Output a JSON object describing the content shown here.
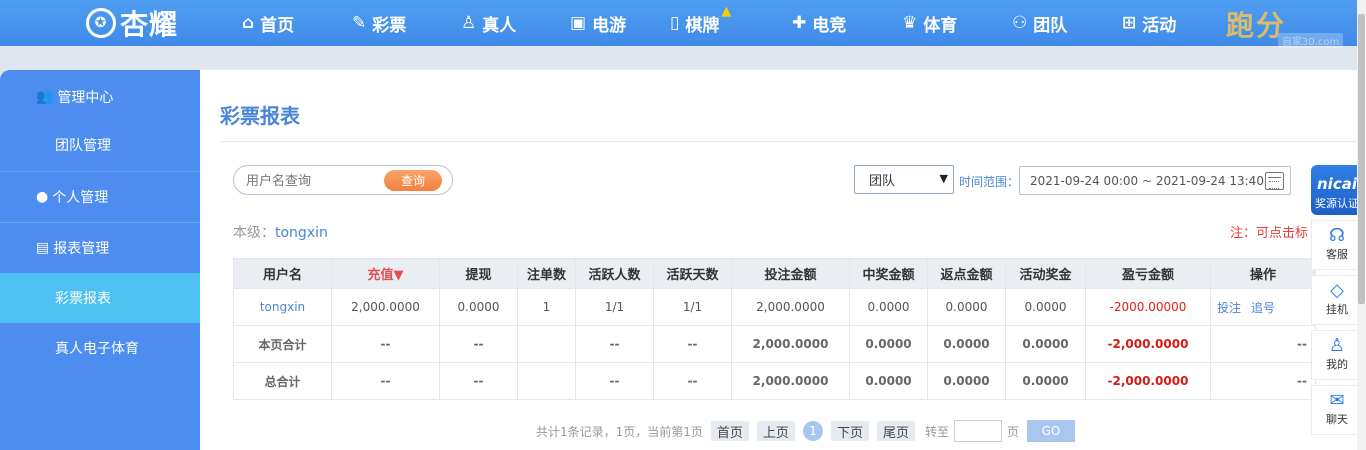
{
  "brand": {
    "logo_text": "杏耀",
    "watermark": "跑分",
    "site_tag": "自家30.com"
  },
  "nav": [
    {
      "label": "首页",
      "icon": "home-icon"
    },
    {
      "label": "彩票",
      "icon": "ticket-icon"
    },
    {
      "label": "真人",
      "icon": "person-icon"
    },
    {
      "label": "电游",
      "icon": "slot-icon"
    },
    {
      "label": "棋牌",
      "icon": "cards-icon"
    },
    {
      "label": "电竞",
      "icon": "gamepad-icon"
    },
    {
      "label": "体育",
      "icon": "trophy-icon"
    },
    {
      "label": "团队",
      "icon": "team-icon"
    },
    {
      "label": "活动",
      "icon": "gift-icon"
    }
  ],
  "sidebar": {
    "groups": [
      {
        "label": "管理中心",
        "icon": "users-icon"
      },
      {
        "label": "团队管理"
      },
      {
        "label": "个人管理",
        "icon": "user-icon"
      },
      {
        "label": "报表管理",
        "icon": "report-icon"
      },
      {
        "label": "彩票报表"
      },
      {
        "label": "真人电子体育"
      }
    ]
  },
  "page": {
    "title": "彩票报表"
  },
  "filters": {
    "search_placeholder": "用户名查询",
    "search_button": "查询",
    "scope_selected": "团队",
    "time_label": "时间范围：",
    "time_range": "2021-09-24 00:00 ~ 2021-09-24 13:40"
  },
  "level": {
    "prefix": "本级：",
    "username": "tongxin"
  },
  "note": "注：可点击标",
  "table": {
    "headers": [
      "用户名",
      "充值▼",
      "提现",
      "注单数",
      "活跃人数",
      "活跃天数",
      "投注金额",
      "中奖金额",
      "返点金额",
      "活动奖金",
      "盈亏金额",
      "操作"
    ],
    "row": {
      "user": "tongxin",
      "recharge": "2,000.0000",
      "withdraw": "0.0000",
      "orders": "1",
      "active_users": "1/1",
      "active_days": "1/1",
      "bet": "2,000.0000",
      "win": "0.0000",
      "rebate": "0.0000",
      "bonus": "0.0000",
      "pnl": "-2000.00000",
      "op1": "投注",
      "op2": "追号"
    },
    "page_total": {
      "label": "本页合计",
      "recharge": "--",
      "withdraw": "--",
      "active_users": "--",
      "active_days": "--",
      "bet": "2,000.0000",
      "win": "0.0000",
      "rebate": "0.0000",
      "bonus": "0.0000",
      "pnl": "-2,000.0000",
      "ops": "--"
    },
    "grand_total": {
      "label": "总合计",
      "recharge": "--",
      "withdraw": "--",
      "active_users": "--",
      "active_days": "--",
      "bet": "2,000.0000",
      "win": "0.0000",
      "rebate": "0.0000",
      "bonus": "0.0000",
      "pnl": "-2,000.0000",
      "ops": "--"
    }
  },
  "pager": {
    "summary": "共计1条记录，1页，当前第1页",
    "first": "首页",
    "prev": "上页",
    "current": "1",
    "next": "下页",
    "last": "尾页",
    "jump_label": "转至",
    "page_unit": "页",
    "go": "GO"
  },
  "float_bar": {
    "badge_title": "nicai",
    "badge_sub": "奖源认证",
    "items": [
      {
        "label": "客服",
        "icon": "headset-icon"
      },
      {
        "label": "挂机",
        "icon": "diamond-icon"
      },
      {
        "label": "我的",
        "icon": "profile-icon"
      },
      {
        "label": "聊天",
        "icon": "chat-icon"
      }
    ]
  }
}
